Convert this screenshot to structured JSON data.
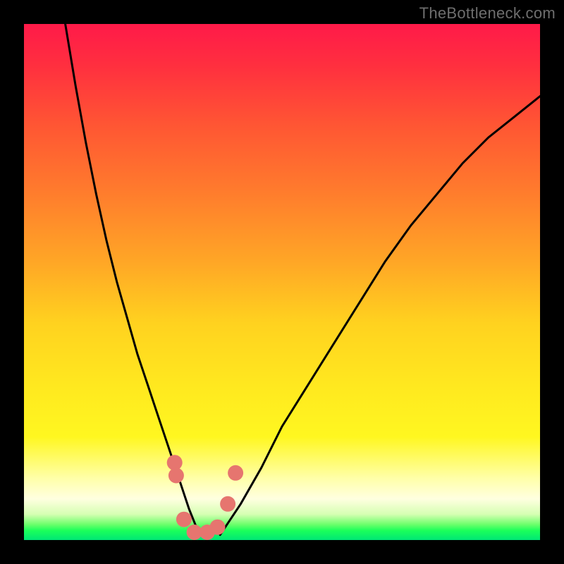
{
  "watermark": "TheBottleneck.com",
  "chart_data": {
    "type": "line",
    "title": "",
    "xlabel": "",
    "ylabel": "",
    "xlim": [
      0,
      100
    ],
    "ylim": [
      0,
      100
    ],
    "series": [
      {
        "name": "left-curve",
        "x": [
          8,
          10,
          12,
          14,
          16,
          18,
          20,
          22,
          24,
          26,
          28,
          30,
          32,
          34
        ],
        "values": [
          100,
          88,
          77,
          67,
          58,
          50,
          43,
          36,
          30,
          24,
          18,
          12,
          6,
          1
        ]
      },
      {
        "name": "right-curve",
        "x": [
          38,
          42,
          46,
          50,
          55,
          60,
          65,
          70,
          75,
          80,
          85,
          90,
          95,
          100
        ],
        "values": [
          1,
          7,
          14,
          22,
          30,
          38,
          46,
          54,
          61,
          67,
          73,
          78,
          82,
          86
        ]
      }
    ],
    "highlighted_points": {
      "name": "pink-dots",
      "x": [
        29.2,
        29.5,
        31.0,
        33.0,
        35.5,
        37.5,
        39.5,
        41.0
      ],
      "values": [
        15.0,
        12.5,
        4.0,
        1.5,
        1.5,
        2.5,
        7.0,
        13.0
      ]
    },
    "background_gradient": {
      "top": "#ff1a49",
      "middle": "#ffe81f",
      "bottom": "#00e676"
    }
  }
}
